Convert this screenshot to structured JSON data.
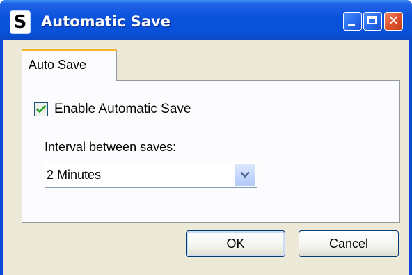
{
  "window": {
    "title": "Automatic Save",
    "app_icon_glyph": "S",
    "close_glyph": "✕"
  },
  "tabs": [
    {
      "label": "Auto Save",
      "selected": true
    }
  ],
  "autosave": {
    "enable_label": "Enable Automatic Save",
    "enabled": true,
    "interval_label": "Interval between saves:",
    "interval_value": "2 Minutes"
  },
  "buttons": {
    "ok_label": "OK",
    "cancel_label": "Cancel"
  },
  "colors": {
    "titlebar": "#0a52dc",
    "tab_accent": "#f8b232",
    "check_mark": "#21a121",
    "dialog_bg": "#ece9d8"
  }
}
